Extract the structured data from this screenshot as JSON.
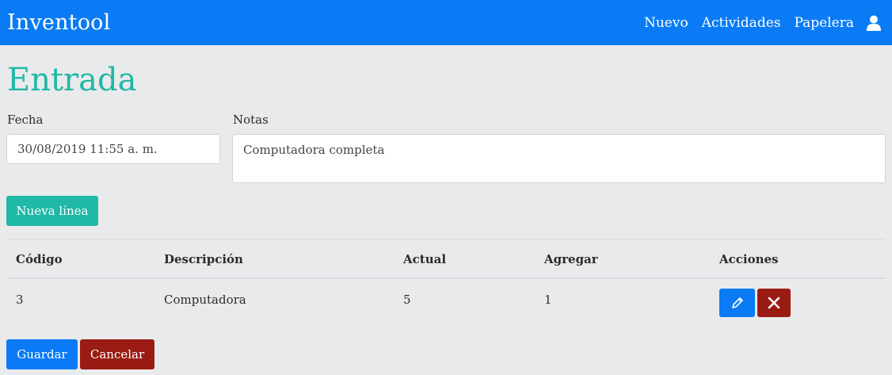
{
  "navbar": {
    "brand": "Inventool",
    "links": [
      "Nuevo",
      "Actividades",
      "Papelera"
    ],
    "user_icon": "user-icon"
  },
  "page": {
    "title": "Entrada"
  },
  "form": {
    "fecha_label": "Fecha",
    "fecha_value": "30/08/2019 11:55 a. m.",
    "notas_label": "Notas",
    "notas_value": "Computadora completa"
  },
  "buttons": {
    "nueva_linea": "Nueva línea",
    "guardar": "Guardar",
    "cancelar": "Cancelar"
  },
  "table": {
    "headers": [
      "Código",
      "Descripción",
      "Actual",
      "Agregar",
      "Acciones"
    ],
    "rows": [
      {
        "codigo": "3",
        "descripcion": "Computadora",
        "actual": "5",
        "agregar": "1",
        "actions": [
          "edit-icon",
          "delete-icon"
        ]
      }
    ]
  },
  "colors": {
    "primary": "#0a7bf5",
    "teal": "#20b8a6",
    "danger": "#9a1b14",
    "background": "#e9eaec"
  }
}
